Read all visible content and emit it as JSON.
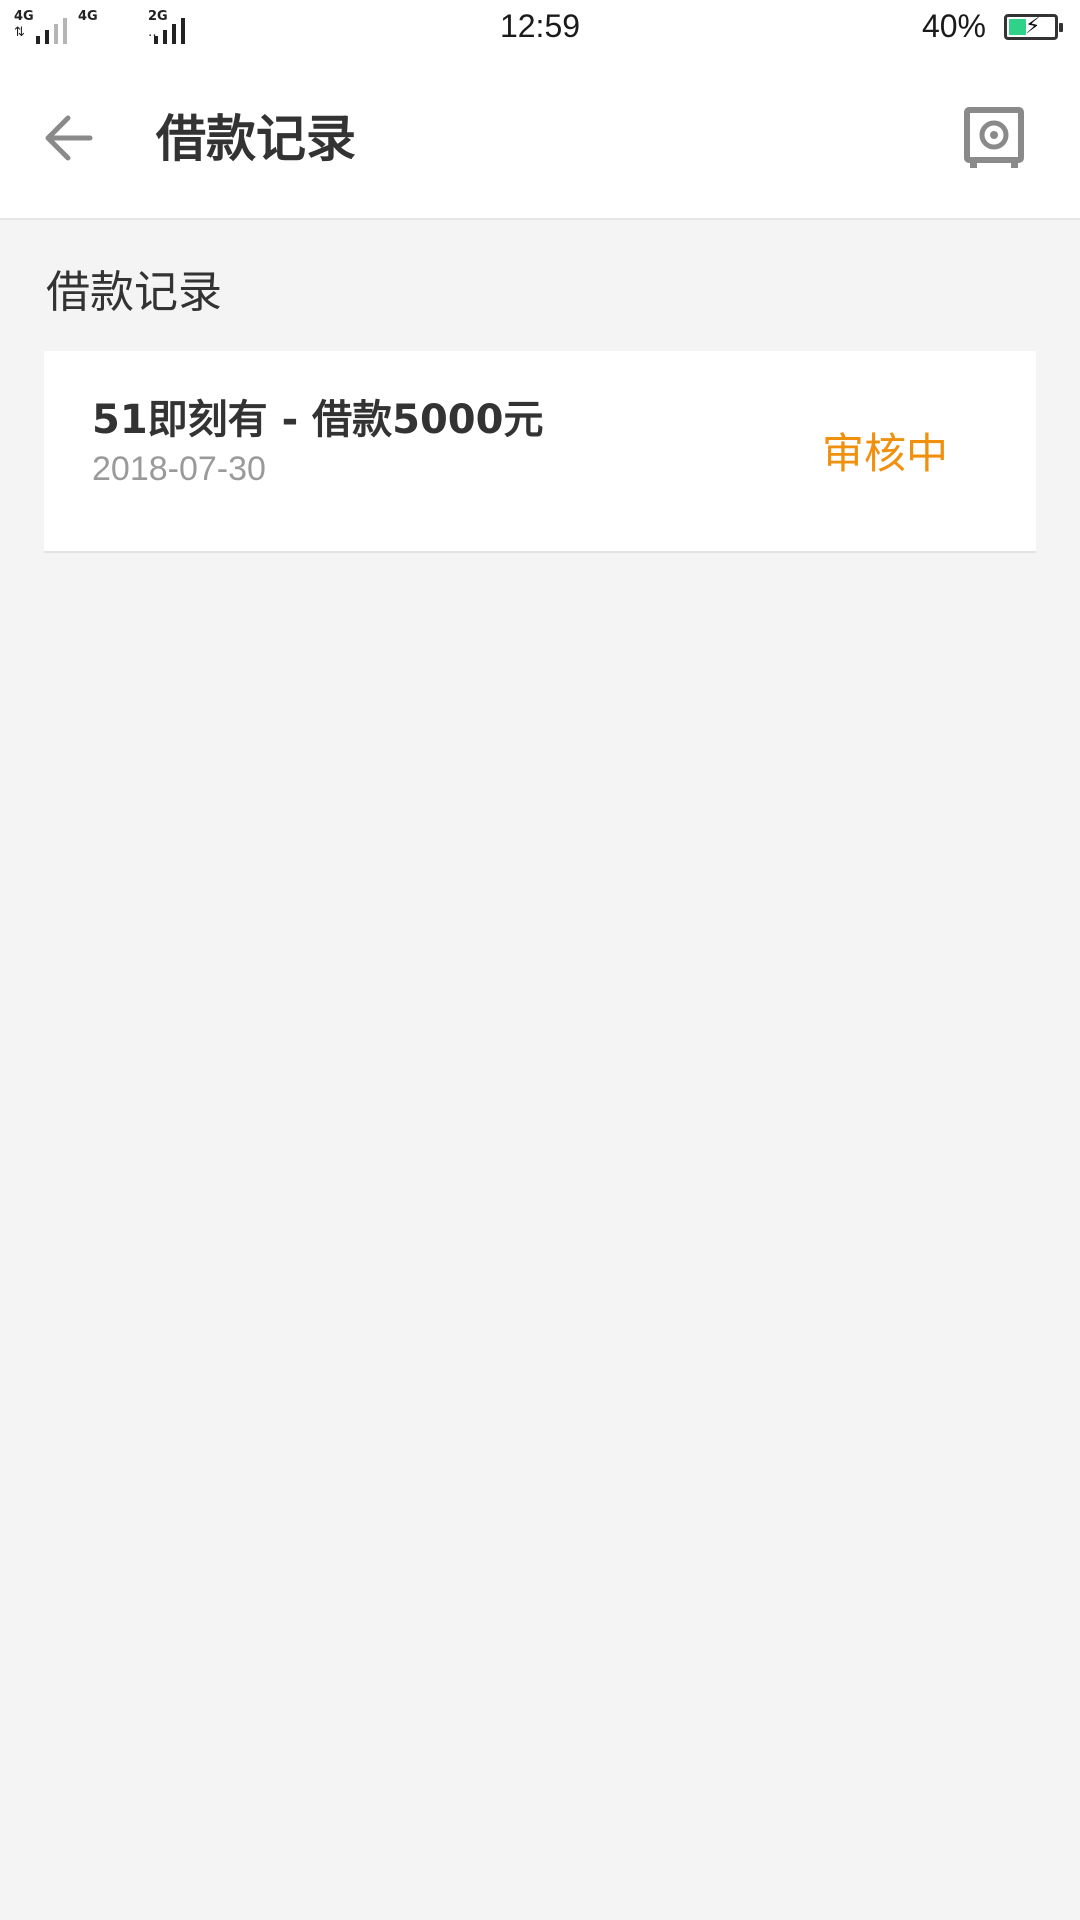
{
  "status_bar": {
    "sim1_network": "4G",
    "sim2_network": "4G",
    "sim3_network": "2G",
    "time": "12:59",
    "battery_percent": "40%",
    "battery_level": 0.4,
    "battery_color": "#2fd289"
  },
  "header": {
    "back_icon": "arrow-left-icon",
    "title": "借款记录",
    "right_icon": "safe-icon"
  },
  "section": {
    "title": "借款记录"
  },
  "records": [
    {
      "title": "51即刻有 - 借款5000元",
      "date": "2018-07-30",
      "status": "审核中",
      "status_color": "#f0900c"
    }
  ]
}
